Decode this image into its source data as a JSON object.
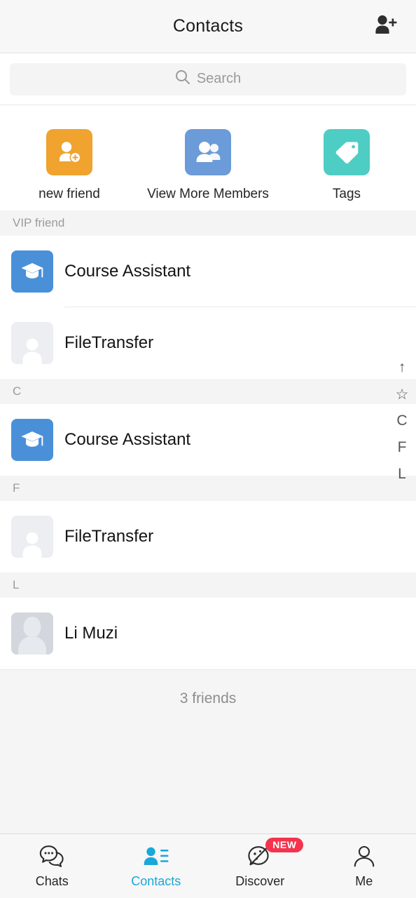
{
  "header": {
    "title": "Contacts",
    "add_friend_icon": "person-add-icon"
  },
  "search": {
    "placeholder": "Search",
    "icon": "search-icon"
  },
  "quick_actions": [
    {
      "label": "new friend",
      "icon": "person-add-square-icon",
      "color": "#f0a32e"
    },
    {
      "label": "View More Members",
      "icon": "group-people-icon",
      "color": "#6b9bd8"
    },
    {
      "label": "Tags",
      "icon": "tag-icon",
      "color": "#4ecdc4"
    }
  ],
  "sections": [
    {
      "header": "VIP friend",
      "contacts": [
        {
          "name": "Course Assistant",
          "avatar": "graduation-cap-avatar"
        },
        {
          "name": "FileTransfer",
          "avatar": "person-placeholder-avatar"
        }
      ]
    },
    {
      "header": "C",
      "contacts": [
        {
          "name": "Course Assistant",
          "avatar": "graduation-cap-avatar"
        }
      ]
    },
    {
      "header": "F",
      "contacts": [
        {
          "name": "FileTransfer",
          "avatar": "person-placeholder-avatar"
        }
      ]
    },
    {
      "header": "L",
      "contacts": [
        {
          "name": "Li Muzi",
          "avatar": "person-photo-avatar"
        }
      ]
    }
  ],
  "friend_count": "3 friends",
  "alpha_index": [
    "↑",
    "☆",
    "C",
    "F",
    "L"
  ],
  "tabbar": {
    "active_color": "#18a8da",
    "tabs": [
      {
        "label": "Chats",
        "icon": "chat-bubbles-icon",
        "active": false,
        "badge": ""
      },
      {
        "label": "Contacts",
        "icon": "contacts-person-list-icon",
        "active": true,
        "badge": ""
      },
      {
        "label": "Discover",
        "icon": "compass-discover-icon",
        "active": false,
        "badge": "NEW"
      },
      {
        "label": "Me",
        "icon": "person-outline-icon",
        "active": false,
        "badge": ""
      }
    ]
  }
}
